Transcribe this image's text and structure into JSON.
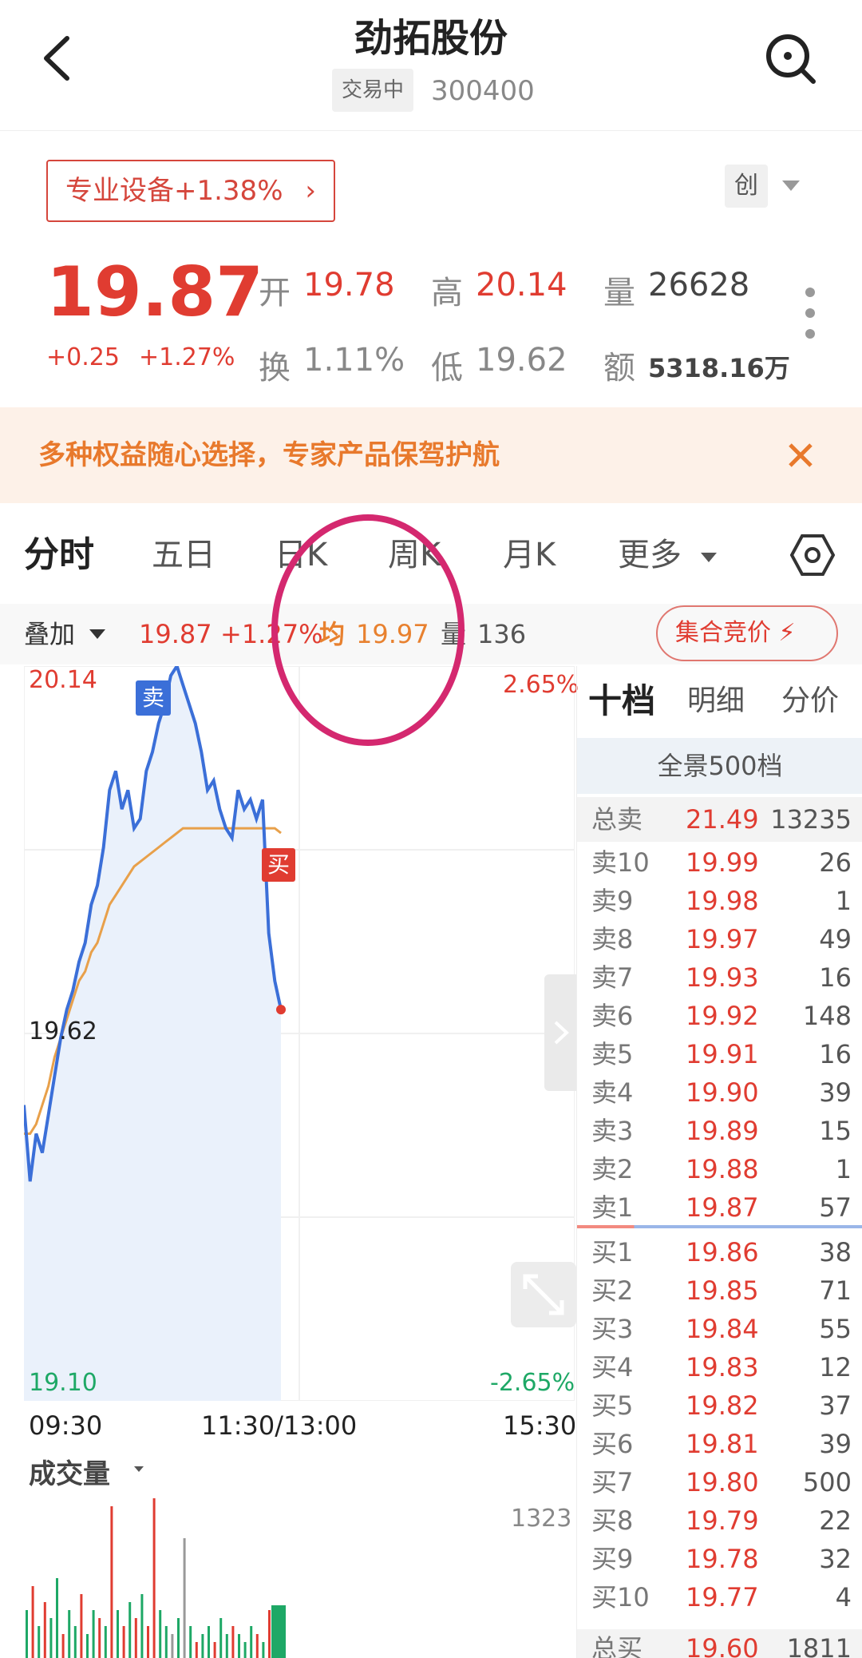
{
  "header": {
    "stock_name": "劲拓股份",
    "status": "交易中",
    "code": "300400"
  },
  "sector": {
    "label": "专业设备+1.38%",
    "chevron": "›",
    "board": "创"
  },
  "quote": {
    "price": "19.87",
    "change": "+0.25",
    "change_pct": "+1.27%",
    "open_label": "开",
    "open": "19.78",
    "high_label": "高",
    "high": "20.14",
    "volume_label": "量",
    "volume": "26628",
    "turnover_label": "换",
    "turnover": "1.11%",
    "low_label": "低",
    "low": "19.62",
    "amount_label": "额",
    "amount": "5318.16万"
  },
  "promo": {
    "text": "多种权益随心选择，专家产品保驾护航"
  },
  "tabs": [
    "分时",
    "五日",
    "日K",
    "周K",
    "月K",
    "更多"
  ],
  "strip": {
    "overlay": "叠加",
    "price": "19.87",
    "pct": "+1.27%",
    "avg_label": "均",
    "avg": "19.97",
    "vol_label": "量",
    "vol": "136",
    "auction": "集合竞价"
  },
  "chart": {
    "high_label": "20.14",
    "high_pct": "2.65%",
    "low_label": "19.62",
    "bottom_label": "19.10",
    "bottom_pct": "-2.65%",
    "time_start": "09:30",
    "time_mid": "11:30/13:00",
    "time_end": "15:30",
    "sell_marker": "卖",
    "buy_marker": "买",
    "colors": {
      "price_line": "#3b6fd8",
      "avg_line": "#e8a04a",
      "fill": "#eaf1fb"
    }
  },
  "chart_data": {
    "type": "line",
    "ylim": [
      19.1,
      20.64
    ],
    "series": [
      {
        "values": [
          19.72,
          19.56,
          19.66,
          19.62,
          19.7,
          19.78,
          19.86,
          19.92,
          19.96,
          20.02,
          20.06,
          20.14,
          20.18,
          20.26,
          20.38,
          20.42,
          20.34,
          20.38,
          20.3,
          20.32,
          20.42,
          20.46,
          20.52,
          20.56,
          20.62,
          20.64,
          20.6,
          20.56,
          20.52,
          20.46,
          20.38,
          20.4,
          20.34,
          20.3,
          20.28,
          20.38,
          20.34,
          20.36,
          20.32,
          20.36,
          20.08,
          19.98,
          19.92
        ]
      },
      {
        "values": [
          19.66,
          19.66,
          19.68,
          19.72,
          19.76,
          19.82,
          19.86,
          19.9,
          19.94,
          19.98,
          20.0,
          20.04,
          20.06,
          20.1,
          20.14,
          20.16,
          20.18,
          20.2,
          20.22,
          20.23,
          20.24,
          20.25,
          20.26,
          20.27,
          20.28,
          20.29,
          20.3,
          20.3,
          20.3,
          20.3,
          20.3,
          20.3,
          20.3,
          20.3,
          20.3,
          20.3,
          20.3,
          20.3,
          20.3,
          20.3,
          20.3,
          20.3,
          20.29
        ]
      }
    ]
  },
  "orderbook": {
    "tabs": [
      "十档",
      "明细",
      "分价"
    ],
    "panorama": "全景500档",
    "total_sell": {
      "label": "总卖",
      "price": "21.49",
      "volume": "13235"
    },
    "sells": [
      {
        "label": "卖10",
        "price": "19.99",
        "volume": "26"
      },
      {
        "label": "卖9",
        "price": "19.98",
        "volume": "1"
      },
      {
        "label": "卖8",
        "price": "19.97",
        "volume": "49"
      },
      {
        "label": "卖7",
        "price": "19.93",
        "volume": "16"
      },
      {
        "label": "卖6",
        "price": "19.92",
        "volume": "148"
      },
      {
        "label": "卖5",
        "price": "19.91",
        "volume": "16"
      },
      {
        "label": "卖4",
        "price": "19.90",
        "volume": "39"
      },
      {
        "label": "卖3",
        "price": "19.89",
        "volume": "15"
      },
      {
        "label": "卖2",
        "price": "19.88",
        "volume": "1"
      },
      {
        "label": "卖1",
        "price": "19.87",
        "volume": "57"
      }
    ],
    "buys": [
      {
        "label": "买1",
        "price": "19.86",
        "volume": "38"
      },
      {
        "label": "买2",
        "price": "19.85",
        "volume": "71"
      },
      {
        "label": "买3",
        "price": "19.84",
        "volume": "55"
      },
      {
        "label": "买4",
        "price": "19.83",
        "volume": "12"
      },
      {
        "label": "买5",
        "price": "19.82",
        "volume": "37"
      },
      {
        "label": "买6",
        "price": "19.81",
        "volume": "39"
      },
      {
        "label": "买7",
        "price": "19.80",
        "volume": "500"
      },
      {
        "label": "买8",
        "price": "19.79",
        "volume": "22"
      },
      {
        "label": "买9",
        "price": "19.78",
        "volume": "32"
      },
      {
        "label": "买10",
        "price": "19.77",
        "volume": "4"
      }
    ],
    "total_buy": {
      "label": "总买",
      "price": "19.60",
      "volume": "1811"
    }
  },
  "volume_panel": {
    "label": "成交量",
    "max": "1323",
    "bars": [
      {
        "v": 0.3,
        "c": "green"
      },
      {
        "v": 0.45,
        "c": "red"
      },
      {
        "v": 0.2,
        "c": "green"
      },
      {
        "v": 0.35,
        "c": "red"
      },
      {
        "v": 0.25,
        "c": "green"
      },
      {
        "v": 0.5,
        "c": "green"
      },
      {
        "v": 0.15,
        "c": "red"
      },
      {
        "v": 0.3,
        "c": "green"
      },
      {
        "v": 0.2,
        "c": "green"
      },
      {
        "v": 0.4,
        "c": "red"
      },
      {
        "v": 0.15,
        "c": "green"
      },
      {
        "v": 0.3,
        "c": "green"
      },
      {
        "v": 0.25,
        "c": "red"
      },
      {
        "v": 0.2,
        "c": "green"
      },
      {
        "v": 0.95,
        "c": "red"
      },
      {
        "v": 0.3,
        "c": "green"
      },
      {
        "v": 0.2,
        "c": "red"
      },
      {
        "v": 0.35,
        "c": "green"
      },
      {
        "v": 0.25,
        "c": "red"
      },
      {
        "v": 0.4,
        "c": "green"
      },
      {
        "v": 0.2,
        "c": "red"
      },
      {
        "v": 1.0,
        "c": "red"
      },
      {
        "v": 0.3,
        "c": "green"
      },
      {
        "v": 0.2,
        "c": "green"
      },
      {
        "v": 0.15,
        "c": "gray"
      },
      {
        "v": 0.25,
        "c": "green"
      },
      {
        "v": 0.75,
        "c": "gray"
      },
      {
        "v": 0.2,
        "c": "green"
      },
      {
        "v": 0.1,
        "c": "red"
      },
      {
        "v": 0.15,
        "c": "green"
      },
      {
        "v": 0.2,
        "c": "green"
      },
      {
        "v": 0.1,
        "c": "red"
      },
      {
        "v": 0.25,
        "c": "green"
      },
      {
        "v": 0.15,
        "c": "green"
      },
      {
        "v": 0.2,
        "c": "red"
      },
      {
        "v": 0.15,
        "c": "green"
      },
      {
        "v": 0.1,
        "c": "green"
      },
      {
        "v": 0.2,
        "c": "green"
      },
      {
        "v": 0.15,
        "c": "red"
      },
      {
        "v": 0.1,
        "c": "green"
      },
      {
        "v": 0.3,
        "c": "red"
      },
      {
        "v": 0.2,
        "c": "green"
      }
    ]
  }
}
